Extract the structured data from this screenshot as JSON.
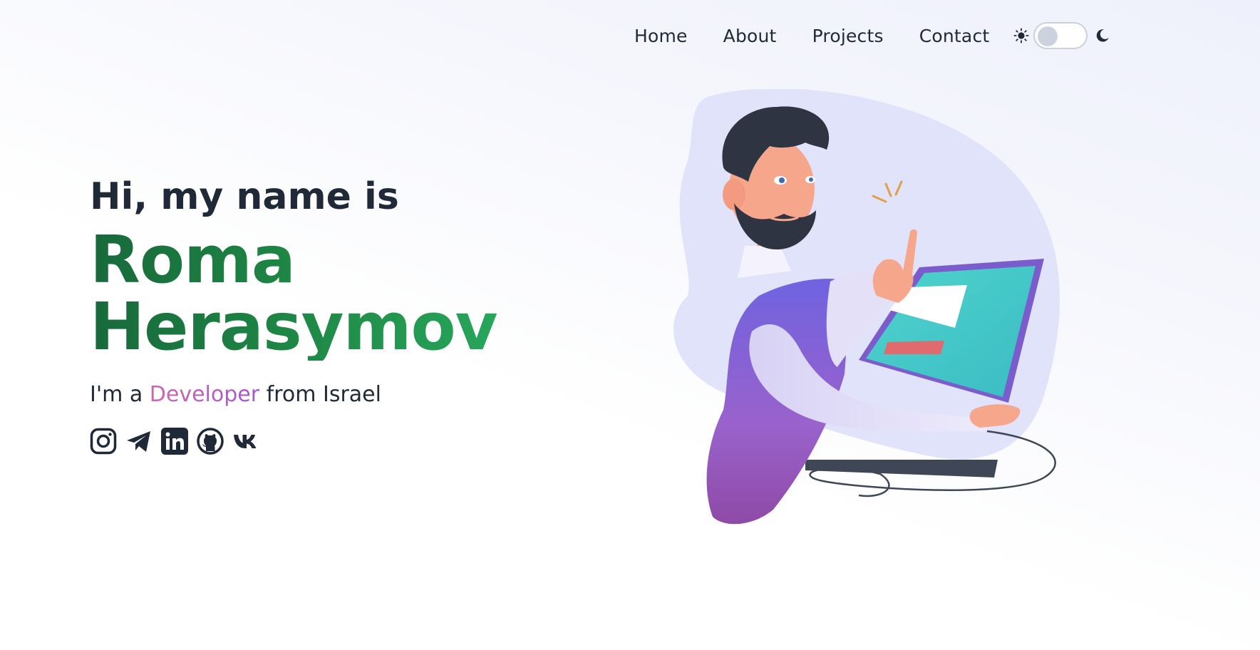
{
  "nav": {
    "items": [
      {
        "label": "Home"
      },
      {
        "label": "About"
      },
      {
        "label": "Projects"
      },
      {
        "label": "Contact"
      }
    ],
    "theme_toggle": {
      "state": "light",
      "icons": [
        "sun-icon",
        "moon-icon"
      ]
    }
  },
  "hero": {
    "greeting": "Hi, my name is",
    "name_first": "Roma",
    "name_last": "Herasymov",
    "tagline_prefix": "I'm a ",
    "tagline_role": "Developer",
    "tagline_suffix": " from Israel",
    "socials": [
      "instagram-icon",
      "telegram-icon",
      "linkedin-icon",
      "github-icon",
      "vk-icon"
    ]
  },
  "colors": {
    "name_gradient": [
      "#17693a",
      "#27a65b"
    ],
    "role_gradient": [
      "#d266aa",
      "#a455d6"
    ],
    "text": "#1f2937",
    "blob": "#e1e3fb",
    "screen": "#45c9c6"
  }
}
